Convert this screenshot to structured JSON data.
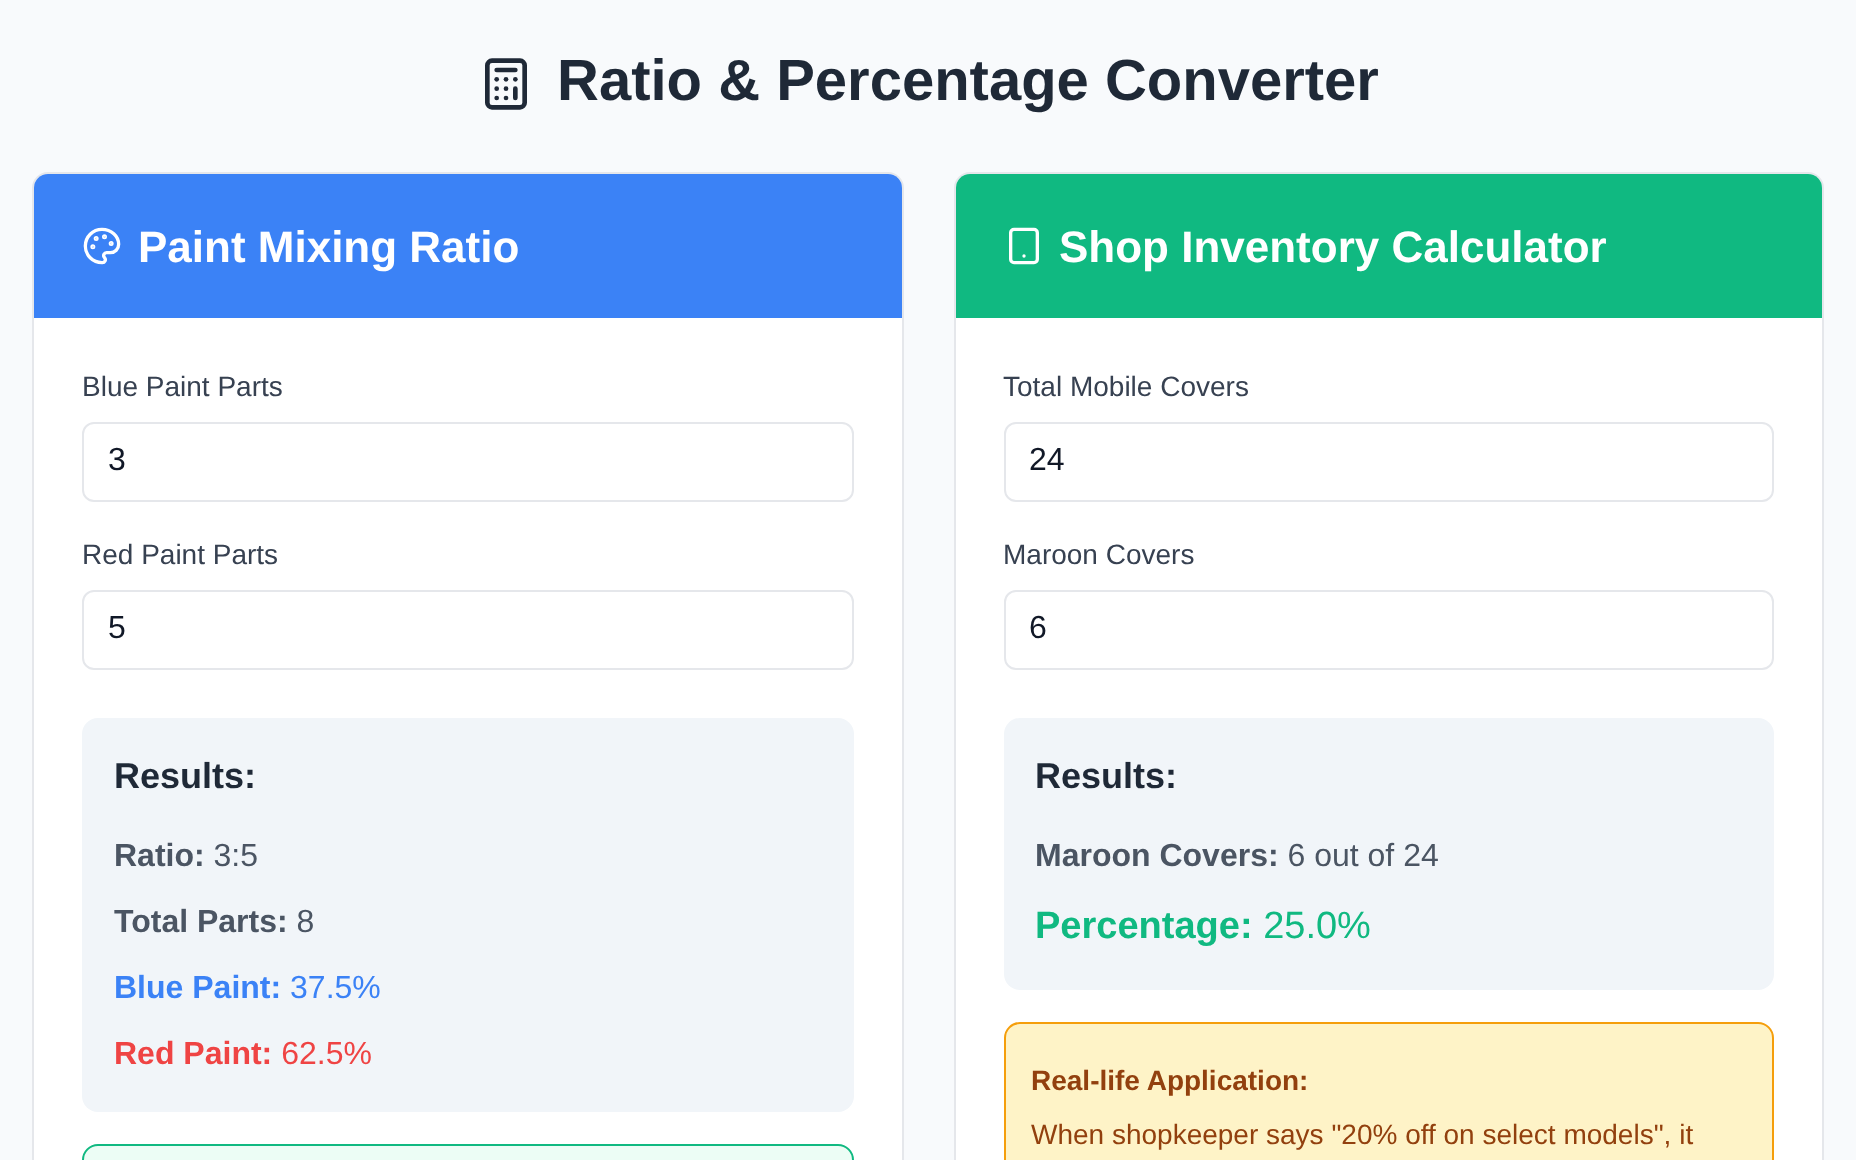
{
  "title": "Ratio & Percentage Converter",
  "cards": [
    {
      "title": "Paint Mixing Ratio",
      "kind": "paint",
      "fields": [
        {
          "label": "Blue Paint Parts",
          "value": "3"
        },
        {
          "label": "Red Paint Parts",
          "value": "5"
        }
      ],
      "results": {
        "heading": "Results:",
        "lines": [
          {
            "kind": "plain",
            "label": "Ratio:",
            "value": "3:5"
          },
          {
            "kind": "plain",
            "label": "Total Parts:",
            "value": "8"
          },
          {
            "kind": "blue",
            "label": "Blue Paint:",
            "value": "37.5%"
          },
          {
            "kind": "red",
            "label": "Red Paint:",
            "value": "62.5%"
          }
        ]
      },
      "note": {
        "kind": "green"
      }
    },
    {
      "title": "Shop Inventory Calculator",
      "kind": "inventory",
      "fields": [
        {
          "label": "Total Mobile Covers",
          "value": "24"
        },
        {
          "label": "Maroon Covers",
          "value": "6"
        }
      ],
      "results": {
        "heading": "Results:",
        "lines": [
          {
            "kind": "plain",
            "label": "Maroon Covers:",
            "value": "6 out of 24"
          },
          {
            "kind": "highlight",
            "label": "Percentage:",
            "value": "25.0%"
          }
        ]
      },
      "note": {
        "kind": "amber",
        "heading": "Real-life Application:",
        "text": "When shopkeeper says \"20% off on select models\", it"
      }
    }
  ]
}
